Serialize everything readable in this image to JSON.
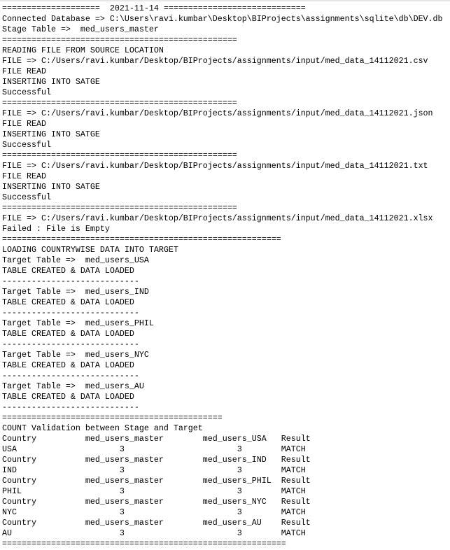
{
  "console": {
    "lines": [
      "====================  2021-11-14 =============================",
      "Connected Database => C:\\Users\\ravi.kumbar\\Desktop\\BIProjects\\assignments\\sqlite\\db\\DEV.db",
      "Stage Table =>  med_users_master",
      "================================================",
      "READING FILE FROM SOURCE LOCATION",
      "FILE => C:/Users/ravi.kumbar/Desktop/BIProjects/assignments/input/med_data_14112021.csv",
      "FILE READ",
      "INSERTING INTO SATGE",
      "Successful",
      "================================================",
      "FILE => C:/Users/ravi.kumbar/Desktop/BIProjects/assignments/input/med_data_14112021.json",
      "FILE READ",
      "INSERTING INTO SATGE",
      "Successful",
      "================================================",
      "FILE => C:/Users/ravi.kumbar/Desktop/BIProjects/assignments/input/med_data_14112021.txt",
      "FILE READ",
      "INSERTING INTO SATGE",
      "Successful",
      "================================================",
      "FILE => C:/Users/ravi.kumbar/Desktop/BIProjects/assignments/input/med_data_14112021.xlsx",
      "Failed : File is Empty",
      "=========================================================",
      "LOADING COUNTRYWISE DATA INTO TARGET",
      "Target Table =>  med_users_USA",
      "TABLE CREATED & DATA LOADED",
      "----------------------------",
      "Target Table =>  med_users_IND",
      "TABLE CREATED & DATA LOADED",
      "----------------------------",
      "Target Table =>  med_users_PHIL",
      "TABLE CREATED & DATA LOADED",
      "----------------------------",
      "Target Table =>  med_users_NYC",
      "TABLE CREATED & DATA LOADED",
      "----------------------------",
      "Target Table =>  med_users_AU",
      "TABLE CREATED & DATA LOADED",
      "----------------------------",
      "=============================================",
      "COUNT Validation between Stage and Target",
      "Country          med_users_master        med_users_USA   Result",
      "USA                     3                       3        MATCH",
      "Country          med_users_master        med_users_IND   Result",
      "IND                     3                       3        MATCH",
      "Country          med_users_master        med_users_PHIL  Result",
      "PHIL                    3                       3        MATCH",
      "Country          med_users_master        med_users_NYC   Result",
      "NYC                     3                       3        MATCH",
      "Country          med_users_master        med_users_AU    Result",
      "AU                      3                       3        MATCH",
      "=========================================================="
    ]
  }
}
